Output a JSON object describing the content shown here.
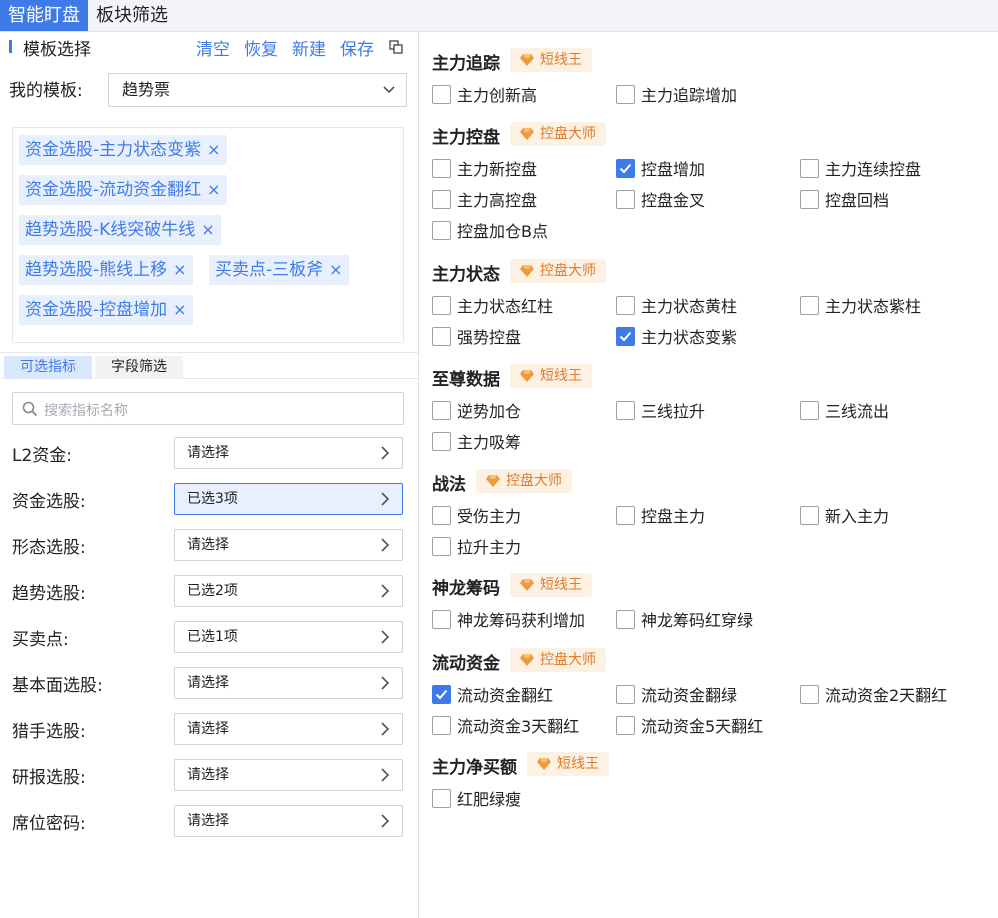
{
  "top_tabs": [
    "智能盯盘",
    "板块筛选"
  ],
  "template": {
    "title": "模板选择",
    "actions": [
      "清空",
      "恢复",
      "新建",
      "保存"
    ],
    "my_label": "我的模板:",
    "selected": "趋势票",
    "tags": [
      "资金选股-主力状态变紫",
      "资金选股-流动资金翻红",
      "趋势选股-K线突破牛线",
      "趋势选股-熊线上移",
      "买卖点-三板斧",
      "资金选股-控盘增加"
    ],
    "tag_close": "×"
  },
  "sub_tabs": [
    "可选指标",
    "字段筛选"
  ],
  "search_placeholder": "搜索指标名称",
  "filters": [
    {
      "label": "L2资金:",
      "value": "请选择"
    },
    {
      "label": "资金选股:",
      "value": "已选3项"
    },
    {
      "label": "形态选股:",
      "value": "请选择"
    },
    {
      "label": "趋势选股:",
      "value": "已选2项"
    },
    {
      "label": "买卖点:",
      "value": "已选1项"
    },
    {
      "label": "基本面选股:",
      "value": "请选择"
    },
    {
      "label": "猎手选股:",
      "value": "请选择"
    },
    {
      "label": "研报选股:",
      "value": "请选择"
    },
    {
      "label": "席位密码:",
      "value": "请选择"
    }
  ],
  "groups": [
    {
      "title": "主力追踪",
      "badge": "短线王",
      "items": [
        {
          "label": "主力创新高",
          "checked": false
        },
        {
          "label": "主力追踪增加",
          "checked": false
        }
      ]
    },
    {
      "title": "主力控盘",
      "badge": "控盘大师",
      "items": [
        {
          "label": "主力新控盘",
          "checked": false
        },
        {
          "label": "控盘增加",
          "checked": true
        },
        {
          "label": "主力连续控盘",
          "checked": false
        },
        {
          "label": "主力高控盘",
          "checked": false
        },
        {
          "label": "控盘金叉",
          "checked": false
        },
        {
          "label": "控盘回档",
          "checked": false
        },
        {
          "label": "控盘加仓B点",
          "checked": false
        }
      ]
    },
    {
      "title": "主力状态",
      "badge": "控盘大师",
      "items": [
        {
          "label": "主力状态红柱",
          "checked": false
        },
        {
          "label": "主力状态黄柱",
          "checked": false
        },
        {
          "label": "主力状态紫柱",
          "checked": false
        },
        {
          "label": "强势控盘",
          "checked": false
        },
        {
          "label": "主力状态变紫",
          "checked": true
        }
      ]
    },
    {
      "title": "至尊数据",
      "badge": "短线王",
      "items": [
        {
          "label": "逆势加仓",
          "checked": false
        },
        {
          "label": "三线拉升",
          "checked": false
        },
        {
          "label": "三线流出",
          "checked": false
        },
        {
          "label": "主力吸筹",
          "checked": false
        }
      ]
    },
    {
      "title": "战法",
      "badge": "控盘大师",
      "items": [
        {
          "label": "受伤主力",
          "checked": false
        },
        {
          "label": "控盘主力",
          "checked": false
        },
        {
          "label": "新入主力",
          "checked": false
        },
        {
          "label": "拉升主力",
          "checked": false
        }
      ]
    },
    {
      "title": "神龙筹码",
      "badge": "短线王",
      "items": [
        {
          "label": "神龙筹码获利增加",
          "checked": false
        },
        {
          "label": "神龙筹码红穿绿",
          "checked": false
        }
      ]
    },
    {
      "title": "流动资金",
      "badge": "控盘大师",
      "items": [
        {
          "label": "流动资金翻红",
          "checked": true
        },
        {
          "label": "流动资金翻绿",
          "checked": false
        },
        {
          "label": "流动资金2天翻红",
          "checked": false
        },
        {
          "label": "流动资金3天翻红",
          "checked": false
        },
        {
          "label": "流动资金5天翻红",
          "checked": false
        }
      ]
    },
    {
      "title": "主力净买额",
      "badge": "短线王",
      "items": [
        {
          "label": "红肥绿瘦",
          "checked": false
        }
      ]
    }
  ],
  "colors": {
    "accent": "#3f7be8",
    "badge_bg": "#fdf1e4",
    "badge_text": "#e07a2a"
  }
}
